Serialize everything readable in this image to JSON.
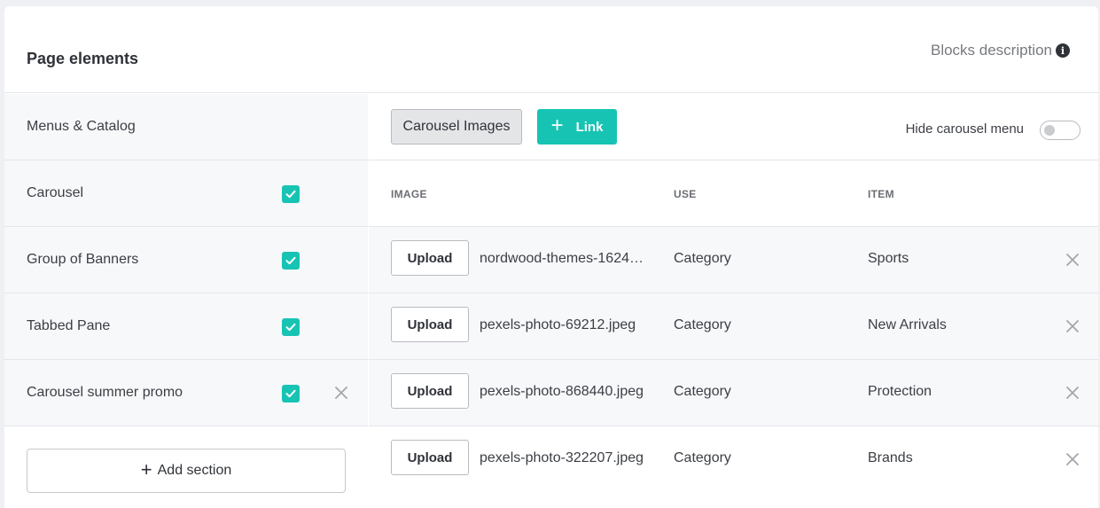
{
  "header": {
    "title": "Page elements",
    "blocks_description": "Blocks description",
    "info_glyph": "i"
  },
  "sidebar": {
    "items": [
      {
        "label": "Menus & Catalog",
        "checked": false,
        "removable": false
      },
      {
        "label": "Carousel",
        "checked": true,
        "removable": false
      },
      {
        "label": "Group of Banners",
        "checked": true,
        "removable": false
      },
      {
        "label": "Tabbed Pane",
        "checked": true,
        "removable": false
      },
      {
        "label": "Carousel summer promo",
        "checked": true,
        "removable": true
      }
    ],
    "add_section_label": "Add section",
    "plus": "+"
  },
  "toolbar": {
    "carousel_images_label": "Carousel Images",
    "link_label": "Link",
    "plus": "+",
    "hide_menu_label": "Hide carousel menu",
    "hide_menu_on": false
  },
  "table": {
    "headers": {
      "image": "IMAGE",
      "use": "USE",
      "item": "ITEM"
    },
    "upload_label": "Upload",
    "rows": [
      {
        "filename": "nordwood-themes-1624…",
        "use": "Category",
        "item": "Sports"
      },
      {
        "filename": "pexels-photo-69212.jpeg",
        "use": "Category",
        "item": "New Arrivals"
      },
      {
        "filename": "pexels-photo-868440.jpeg",
        "use": "Category",
        "item": "Protection"
      },
      {
        "filename": "pexels-photo-322207.jpeg",
        "use": "Category",
        "item": "Brands"
      }
    ]
  },
  "colors": {
    "accent": "#17c4b4",
    "row_bg": "#f7f8fa",
    "border": "#e4e6ea",
    "text": "#2f3238",
    "muted": "#77797e"
  },
  "icons": {
    "check": "check-icon",
    "remove": "close-icon",
    "info": "info-icon",
    "plus": "plus-icon"
  }
}
